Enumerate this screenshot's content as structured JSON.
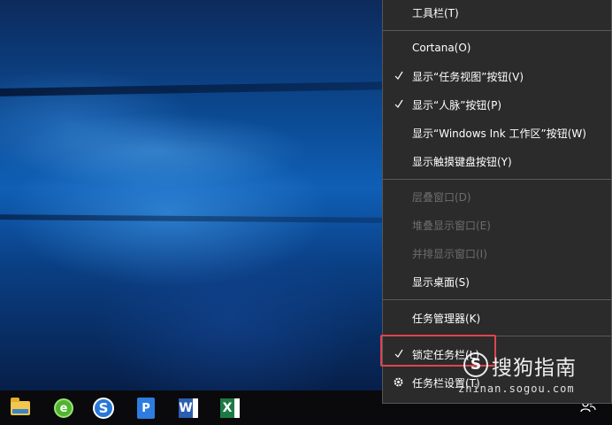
{
  "context_menu": {
    "items": [
      {
        "label": "工具栏(T)",
        "checked": false,
        "enabled": true
      },
      {
        "label": "Cortana(O)",
        "checked": false,
        "enabled": true
      },
      {
        "label": "显示“任务视图”按钮(V)",
        "checked": true,
        "enabled": true
      },
      {
        "label": "显示“人脉”按钮(P)",
        "checked": true,
        "enabled": true
      },
      {
        "label": "显示“Windows Ink 工作区”按钮(W)",
        "checked": false,
        "enabled": true
      },
      {
        "label": "显示触摸键盘按钮(Y)",
        "checked": false,
        "enabled": true
      },
      {
        "label": "层叠窗口(D)",
        "checked": false,
        "enabled": false
      },
      {
        "label": "堆叠显示窗口(E)",
        "checked": false,
        "enabled": false
      },
      {
        "label": "并排显示窗口(I)",
        "checked": false,
        "enabled": false
      },
      {
        "label": "显示桌面(S)",
        "checked": false,
        "enabled": true
      },
      {
        "label": "任务管理器(K)",
        "checked": false,
        "enabled": true
      },
      {
        "label": "锁定任务栏(L)",
        "checked": true,
        "enabled": true
      },
      {
        "label": "任务栏设置(T)",
        "checked": false,
        "enabled": true,
        "icon": "gear-icon"
      }
    ]
  },
  "taskbar": {
    "icons": [
      "folder-icon",
      "browser-icon",
      "sogou-icon",
      "app-icon",
      "word-icon",
      "excel-icon",
      "people-icon"
    ]
  },
  "watermark": {
    "logo_letter": "S",
    "title": "搜狗指南",
    "url": "zhinan.sogou.com"
  },
  "colors": {
    "menu_bg": "#2b2b2b",
    "menu_text": "#ffffff",
    "menu_disabled_text": "#6d6d6d",
    "highlight_border": "#e0444d",
    "taskbar_bg": "#0a0a0c"
  }
}
